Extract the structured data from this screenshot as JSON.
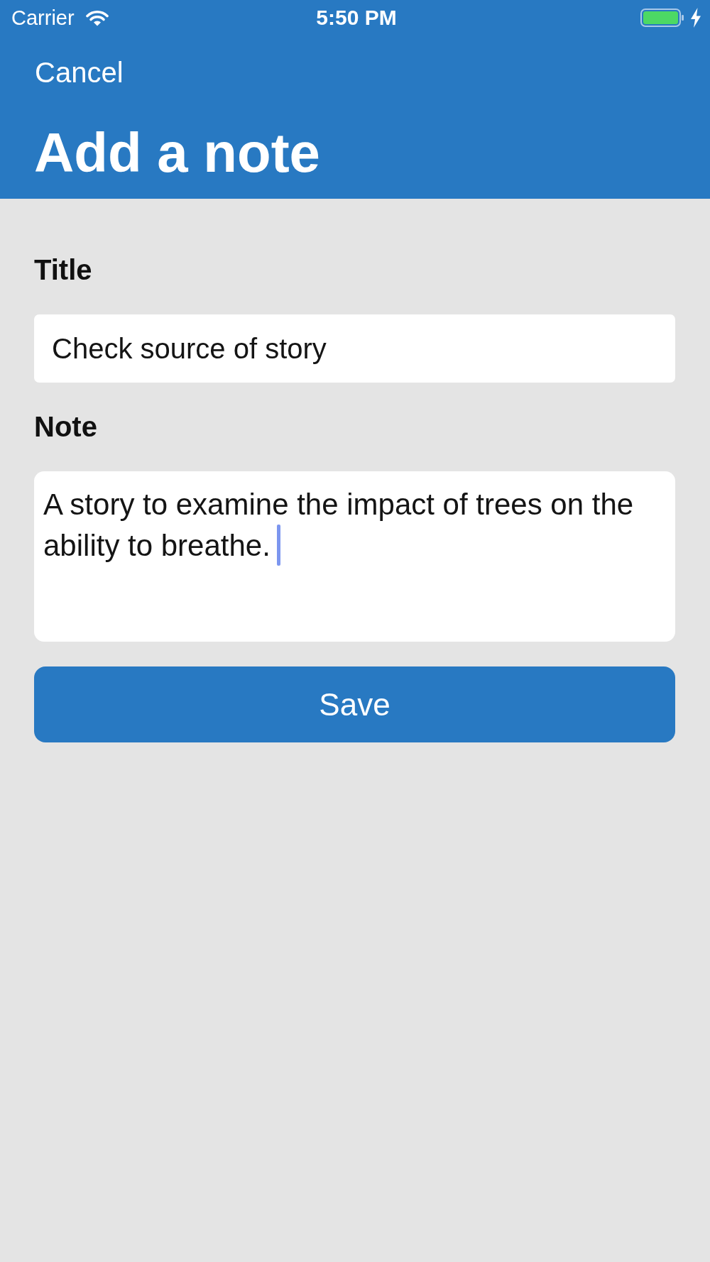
{
  "status_bar": {
    "carrier": "Carrier",
    "time": "5:50 PM",
    "charging": true
  },
  "navigation": {
    "cancel_button": "Cancel",
    "title": "Add a note"
  },
  "form": {
    "fields": [
      {
        "kind": "single_line",
        "label": "Title",
        "value": "Check source of story",
        "focused": false
      },
      {
        "kind": "multi_line",
        "label": "Note",
        "value": "A story to examine the impact of trees on the ability to breathe.",
        "focused": true
      }
    ],
    "save_button": "Save"
  }
}
